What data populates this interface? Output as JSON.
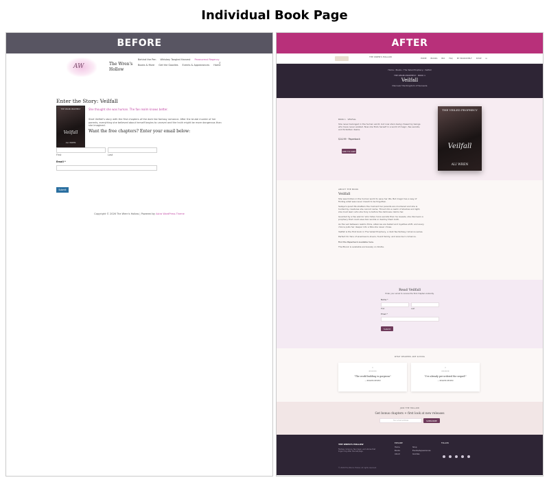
{
  "page_title": "Individual Book Page",
  "panels": {
    "before_label": "BEFORE",
    "after_label": "AFTER"
  },
  "before": {
    "site_name": "The Wren's Hollow",
    "logo_text": "AW",
    "nav": [
      "Behind the Pen",
      "Whiskey Tangled Harvest",
      "Paranormal Regency",
      "Books & More",
      "Get the Goodies",
      "Events & Appearances",
      "Home"
    ],
    "heading": "Enter the Story: Veilfall",
    "tagline": "She thought she was human. The fae realm knows better.",
    "paragraph": "Start Veilfall's story with the first chapters of the dark fae fantasy romance. After the brutal murder of her parents, everything she believed about herself begins to unravel and the truth might be more dangerous than she imagined.",
    "cta_heading": "Want the free chapters? Enter your email below:",
    "cover": {
      "top": "THE VEILED PROPHECY",
      "title": "Veilfall",
      "author": "ALI WREN"
    },
    "form": {
      "name_label": "Name *",
      "first": "First",
      "last": "Last",
      "email_label": "Email *",
      "submit": "Submit"
    },
    "footer_text": "Copyright © 2026 The Wren's Hollow | Powered by",
    "footer_link": "Astra WordPress Theme"
  },
  "after": {
    "brand": "THE WREN'S HOLLOW",
    "nav": [
      "HOME",
      "BOOKS",
      "BIO",
      "FAQ",
      "MY BOOKSHELF",
      "SHOP"
    ],
    "breadcrumb": "Home  ›  Books  ›  The Veiled Prophecy  ›  Veilfall",
    "series": "THE VEILED PROPHECY · BOOK 1",
    "title": "Veilfall",
    "subtitle": "Discover the Kingdom of Sunseria",
    "meta": "BOOK 1 · VEILFALL",
    "blurb": "She never belonged in the human world, but now she's being chased by beings who have never existed. Now she finds herself in a world of magic, fae secrets, and forbidden desire.",
    "price": "$14.99 · Paperback",
    "add_btn": "ADD TO CART",
    "cover": {
      "top": "THE VEILED PROPHECY",
      "title": "Veilfall",
      "author": "ALI WREN"
    },
    "about": {
      "label": "ABOUT THE BOOK",
      "title": "Veilfall",
      "paragraphs": [
        "She was hidden in the human world to save her life. But magic has a way of finding what was never meant to be forgotten.",
        "Selaya's quiet life shatters the moment her parents are murdered and she is hunted by creatures she cannot name. Thrust into a realm of shadow and light, she must learn who she truly is before the darkness claims her.",
        "Guarded by a fae warrior who hides more secrets than he reveals, she discovers a prophecy that could save two worlds or destroy them both.",
        "As the veil between realms thins, alliances are tested and loyalties shift, and every choice pulls her deeper into a fate she never chose.",
        "Veilfall is the first book in The Veiled Prophecy, a dark fae fantasy romance series.",
        "Perfect for fans of enemies-to-lovers, found family, and slow burn romance.",
        "Find the Paperback available here.",
        "The Ebook is available exclusively on Kindle."
      ]
    },
    "read": {
      "title": "Read Veilfall",
      "sub": "Enter your email to receive the first chapters instantly.",
      "name_label": "Name *",
      "first": "First",
      "last": "Last",
      "email_label": "Email *",
      "submit": "Submit"
    },
    "reviews": {
      "label": "WHAT READERS ARE SAYING",
      "items": [
        {
          "stars": "★★★★★",
          "quote": "\"The world building is gorgeous\"",
          "by": "— READER REVIEW"
        },
        {
          "stars": "★★★★★",
          "quote": "\"I've already pre-ordered the sequel!\"",
          "by": "— READER REVIEW"
        }
      ]
    },
    "newsletter": {
      "label": "JOIN THE HOLLOW",
      "title": "Get bonus chapters + first look at new releases",
      "placeholder": "Your email address",
      "button": "SUBSCRIBE"
    },
    "footer": {
      "brand": "THE WREN'S HOLLOW",
      "tag": "Fantasy romance, fae magic, and stories that linger long after the last page.",
      "explore_head": "EXPLORE",
      "col1": [
        "Home",
        "Books",
        "About"
      ],
      "col2": [
        "Shop",
        "Events/Appearances",
        "Goodies"
      ],
      "follow_head": "FOLLOW",
      "copyright": "© 2026 The Wren's Hollow. All rights reserved."
    }
  },
  "colors": {
    "before_header": "#585562",
    "after_header": "#b8307a",
    "accent": "#c24aa6",
    "dark": "#2e2535",
    "plum": "#6e3a5a"
  }
}
